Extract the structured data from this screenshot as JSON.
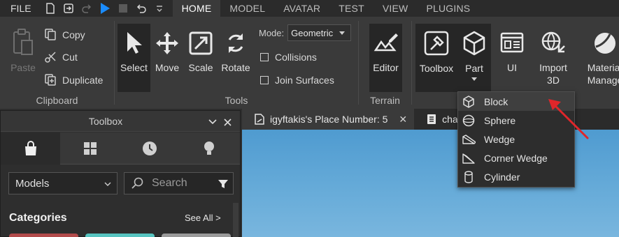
{
  "topbar": {
    "file_label": "FILE",
    "tabs": [
      {
        "label": "HOME",
        "active": true
      },
      {
        "label": "MODEL"
      },
      {
        "label": "AVATAR"
      },
      {
        "label": "TEST"
      },
      {
        "label": "VIEW"
      },
      {
        "label": "PLUGINS"
      }
    ]
  },
  "ribbon": {
    "clipboard": {
      "paste_label": "Paste",
      "copy_label": "Copy",
      "cut_label": "Cut",
      "duplicate_label": "Duplicate",
      "group_label": "Clipboard"
    },
    "tools": {
      "select_label": "Select",
      "move_label": "Move",
      "scale_label": "Scale",
      "rotate_label": "Rotate",
      "mode_label": "Mode:",
      "mode_value": "Geometric",
      "collisions_label": "Collisions",
      "join_surfaces_label": "Join Surfaces",
      "group_label": "Tools"
    },
    "terrain": {
      "editor_label": "Editor",
      "group_label": "Terrain"
    },
    "insert": {
      "toolbox_label": "Toolbox",
      "part_label": "Part",
      "ui_label": "UI",
      "import3d_line1": "Import",
      "import3d_line2": "3D",
      "material_line1": "Materia",
      "material_line2": "Manage"
    }
  },
  "toolbox_panel": {
    "title": "Toolbox",
    "models_value": "Models",
    "search_placeholder": "Search",
    "categories_label": "Categories",
    "see_all_label": "See All >",
    "category_colors": [
      "#b24b4b",
      "#57c4c0",
      "#9a9a9a"
    ]
  },
  "doc_tabs": [
    {
      "label": "igyftakis's Place Number: 5",
      "active": true
    },
    {
      "label": "cha"
    }
  ],
  "part_menu": {
    "items": [
      {
        "label": "Block",
        "icon": "cube-icon"
      },
      {
        "label": "Sphere",
        "icon": "sphere-icon"
      },
      {
        "label": "Wedge",
        "icon": "wedge-icon"
      },
      {
        "label": "Corner Wedge",
        "icon": "corner-wedge-icon"
      },
      {
        "label": "Cylinder",
        "icon": "cylinder-icon"
      }
    ]
  },
  "colors": {
    "accent_blue": "#1a8cff",
    "annotation_arrow": "#e0262a",
    "sky": "#68acd9"
  }
}
